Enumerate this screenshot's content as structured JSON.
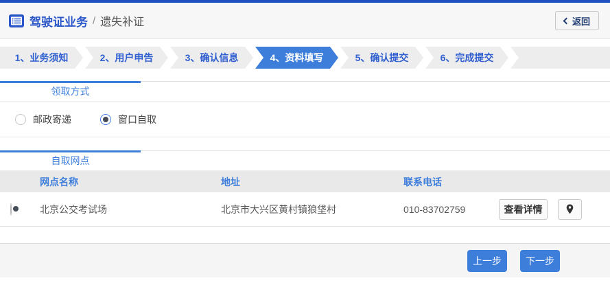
{
  "colors": {
    "top_bar": "#1e50c2",
    "accent": "#3d7edb",
    "step_text": "#2f5fd0"
  },
  "header": {
    "icon": "license-form-icon",
    "title": "驾驶证业务",
    "separator": "/",
    "subtitle": "遗失补证",
    "back": {
      "icon": "chevron-left",
      "label": "返回"
    }
  },
  "steps": {
    "items": [
      {
        "label": "1、业务须知",
        "active": false
      },
      {
        "label": "2、用户申告",
        "active": false
      },
      {
        "label": "3、确认信息",
        "active": false
      },
      {
        "label": "4、资料填写",
        "active": true
      },
      {
        "label": "5、确认提交",
        "active": false
      },
      {
        "label": "6、完成提交",
        "active": false
      }
    ]
  },
  "pickup": {
    "title": "领取方式",
    "options": [
      {
        "label": "邮政寄递",
        "selected": false
      },
      {
        "label": "窗口自取",
        "selected": true
      }
    ]
  },
  "outlets": {
    "title": "自取网点",
    "columns": {
      "name": "网点名称",
      "address": "地址",
      "phone": "联系电话"
    },
    "rows": [
      {
        "selected": true,
        "name": "北京公交考试场",
        "address": "北京市大兴区黄村镇狼垡村",
        "phone": "010-83702759",
        "detail_label": "查看详情",
        "map_icon": "location-pin"
      }
    ]
  },
  "footer": {
    "prev": "上一步",
    "next": "下一步"
  }
}
